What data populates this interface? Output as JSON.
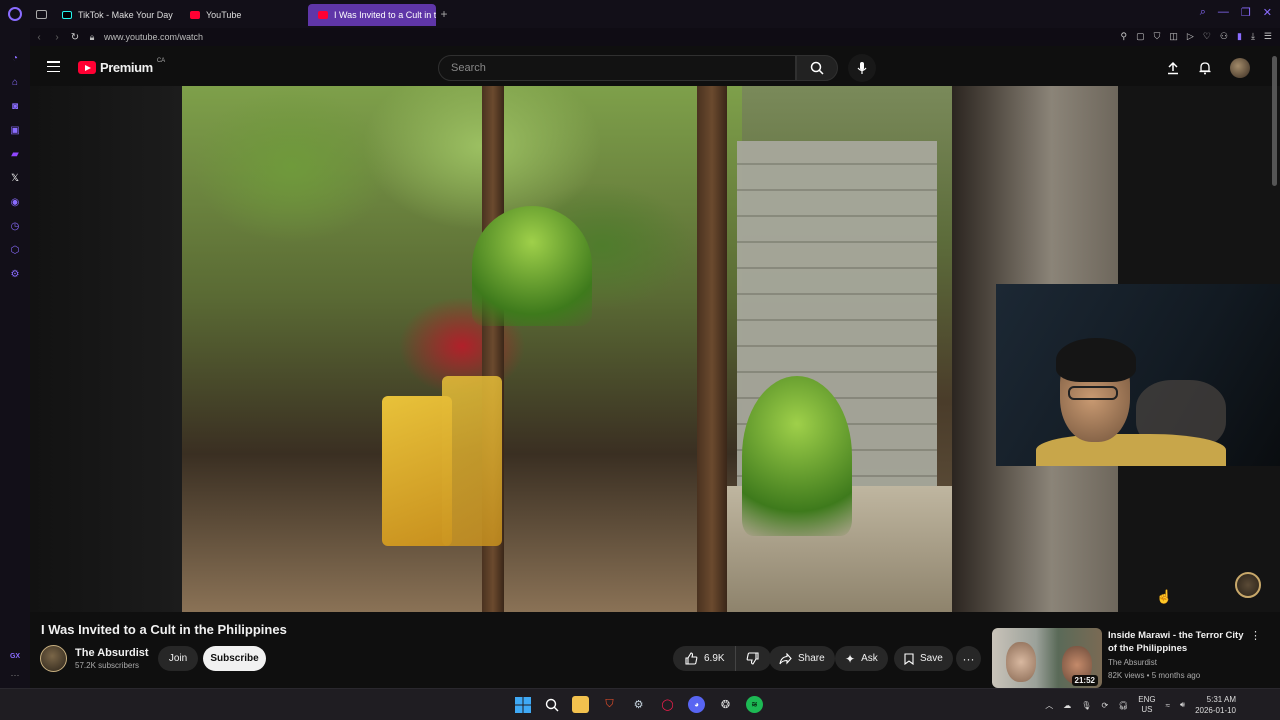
{
  "browser": {
    "tabs": [
      {
        "label": "TikTok - Make Your Day",
        "active": false,
        "icon": "tiktok-icon"
      },
      {
        "label": "YouTube",
        "active": false,
        "icon": "youtube-icon"
      },
      {
        "label": "I Was Invited to a Cult in th",
        "active": true,
        "icon": "youtube-icon"
      }
    ],
    "url": "www.youtube.com/watch"
  },
  "youtube": {
    "logo_text": "Premium",
    "logo_region": "CA",
    "search_placeholder": "Search"
  },
  "video": {
    "title": "I Was Invited to a Cult in the Philippines",
    "channel_name": "The Absurdist",
    "subscribers": "57.2K subscribers",
    "join_label": "Join",
    "subscribe_label": "Subscribe",
    "likes": "6.9K",
    "share_label": "Share",
    "ask_label": "Ask",
    "save_label": "Save"
  },
  "recommendation": {
    "title": "Inside Marawi - the Terror City of the Philippines",
    "channel": "The Absurdist",
    "meta": "82K views • 5 months ago",
    "duration": "21:52"
  },
  "taskbar": {
    "lang_top": "ENG",
    "lang_bottom": "US",
    "time": "5:31 AM",
    "date": "2026-01-10"
  },
  "sidebar": {
    "gx_label": "GX"
  },
  "colors": {
    "accent": "#8a6cff",
    "youtube_red": "#ff0033",
    "active_tab": "#5f36a8"
  }
}
